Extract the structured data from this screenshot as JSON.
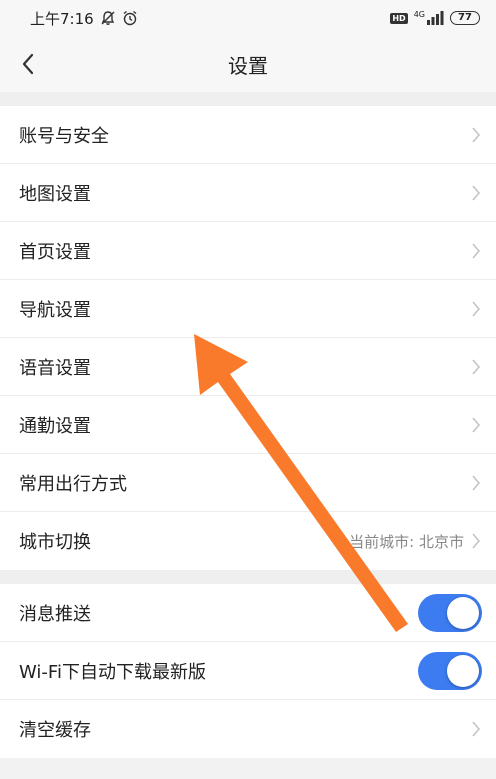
{
  "status_bar": {
    "time": "上午7:16",
    "network": "4G",
    "battery": "77"
  },
  "navbar": {
    "title": "设置"
  },
  "group1": {
    "items": [
      {
        "label": "账号与安全"
      },
      {
        "label": "地图设置"
      },
      {
        "label": "首页设置"
      },
      {
        "label": "导航设置"
      },
      {
        "label": "语音设置"
      },
      {
        "label": "通勤设置"
      },
      {
        "label": "常用出行方式"
      },
      {
        "label": "城市切换",
        "value": "当前城市: 北京市"
      }
    ]
  },
  "group2": {
    "items": [
      {
        "label": "消息推送",
        "toggle": true
      },
      {
        "label": "Wi-Fi下自动下载最新版",
        "toggle": true
      },
      {
        "label": "清空缓存"
      }
    ]
  },
  "colors": {
    "toggle_on": "#3c7bf0",
    "annotation_arrow": "#f97a2b"
  }
}
